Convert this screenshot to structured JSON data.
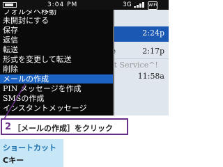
{
  "status_bar": {
    "time": "3:04 PM",
    "network": "3G",
    "wifi_label": "WiFi",
    "icons": [
      "battery-icon",
      "signal-bars-icon",
      "wifi-icon"
    ]
  },
  "inbox": {
    "rows": [
      {
        "time": "2:24p",
        "text": ""
      },
      {
        "time": "2:17p",
        "text": "ice"
      },
      {
        "time": "11:58a",
        "text": "net Service^!"
      }
    ]
  },
  "menu": {
    "items": [
      "フォルダへ移動",
      "未開封にする",
      "保存",
      "返信",
      "転送",
      "形式を変更して転送",
      "削除",
      "メールの作成",
      "PIN メッセージを作成",
      "SMSの作成",
      "インスタントメッセージ"
    ],
    "selected_index": 7
  },
  "callout": {
    "step": "2",
    "text": "［メールの作成］をクリック"
  },
  "shortcut": {
    "title": "ショートカット",
    "key": "Cキー"
  },
  "colors": {
    "accent": "#6a2f86",
    "selection": "#1d63c4",
    "shortcut_bg": "#c7e6f6",
    "shortcut_title": "#1a6fae"
  }
}
